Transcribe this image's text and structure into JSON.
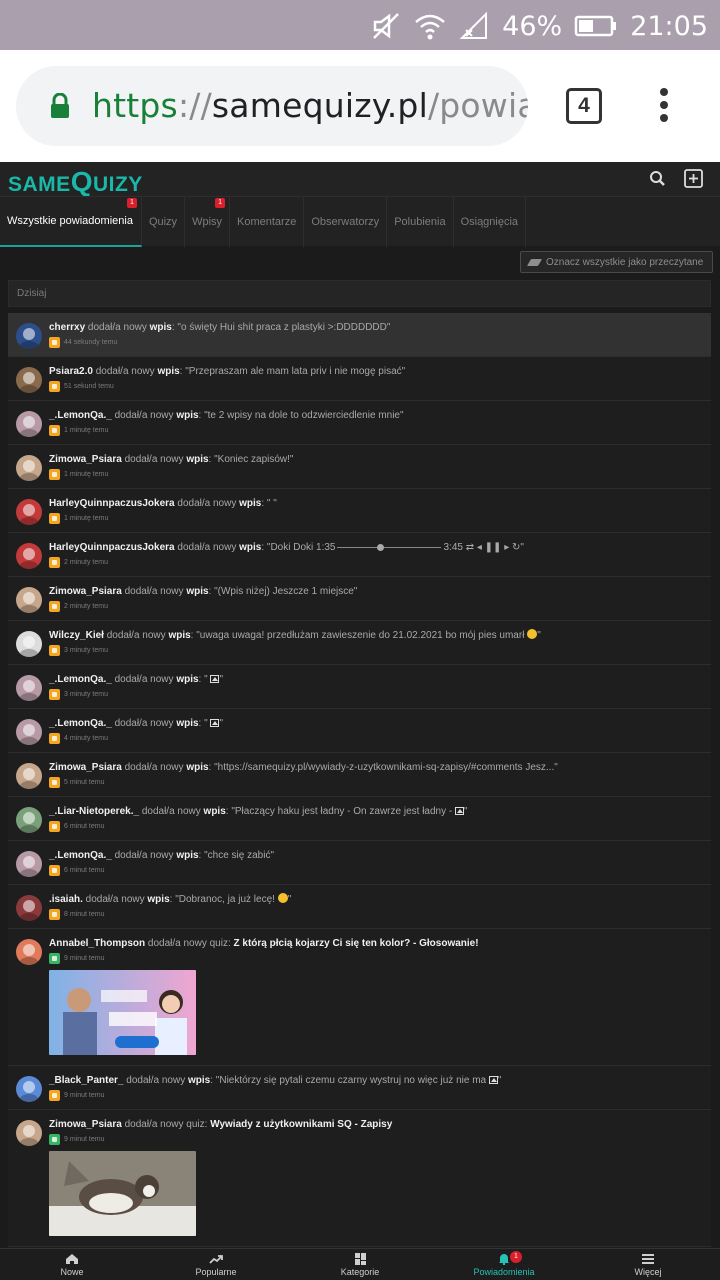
{
  "status_bar": {
    "battery": "46%",
    "time": "21:05"
  },
  "browser": {
    "url_scheme": "https",
    "url_sep": "://",
    "url_host": "samequizy.pl",
    "url_path": "/powiadomienia",
    "tab_count": "4"
  },
  "site": {
    "logo_prefix": "same",
    "logo_q": "Q",
    "logo_suffix": "uizy"
  },
  "tabs": [
    {
      "label": "Wszystkie powiadomienia",
      "badge": "1",
      "active": true
    },
    {
      "label": "Quizy",
      "badge": ""
    },
    {
      "label": "Wpisy",
      "badge": "1"
    },
    {
      "label": "Komentarze",
      "badge": ""
    },
    {
      "label": "Obserwatorzy",
      "badge": ""
    },
    {
      "label": "Polubienia",
      "badge": ""
    },
    {
      "label": "Osiągnięcia",
      "badge": ""
    }
  ],
  "mark_all_label": "Oznacz wszystkie jako przeczytane",
  "section_label": "Dzisiaj",
  "notifications": [
    {
      "user": "cherrxy",
      "action": " dodał/a nowy ",
      "kw": "wpis",
      "text": ": \"o święty Hui shit praca z plastyki >:DDDDDDD\"",
      "time": "44 sekundy temu",
      "type": "post",
      "avatar": "#2c4f8c"
    },
    {
      "user": "Psiara2.0",
      "action": " dodał/a nowy ",
      "kw": "wpis",
      "text": ": \"Przepraszam ale mam lata priv i nie mogę pisać\"",
      "time": "51 sekund temu",
      "type": "post",
      "avatar": "#8a6a4d"
    },
    {
      "user": "_.LemonQa._",
      "action": " dodał/a nowy ",
      "kw": "wpis",
      "text": ": \"te 2 wpisy na dole to odzwierciedlenie mnie\"",
      "time": "1 minutę temu",
      "type": "post",
      "avatar": "#b79aa6"
    },
    {
      "user": "Zimowa_Psiara",
      "action": " dodał/a nowy ",
      "kw": "wpis",
      "text": ": \"Koniec zapisów!\"",
      "time": "1 minutę temu",
      "type": "post",
      "avatar": "#c7a78c"
    },
    {
      "user": "HarleyQuinnpaczusJokera",
      "action": " dodał/a nowy ",
      "kw": "wpis",
      "text": ": \"                               \"",
      "time": "1 minutę temu",
      "type": "post",
      "avatar": "#c23a3a"
    },
    {
      "user": "HarleyQuinnpaczusJokera",
      "action": " dodał/a nowy ",
      "kw": "wpis",
      "text": ": \"Doki Doki 1:35",
      "text_after": "3:45 ⇄        ◂    ❚❚    ▸          ↻\"",
      "player": true,
      "time": "2 minuty temu",
      "type": "post",
      "avatar": "#c23a3a"
    },
    {
      "user": "Zimowa_Psiara",
      "action": " dodał/a nowy ",
      "kw": "wpis",
      "text": ": \"(Wpis niżej) Jeszcze 1 miejsce\"",
      "time": "2 minuty temu",
      "type": "post",
      "avatar": "#c7a78c"
    },
    {
      "user": "Wilczy_Kieł",
      "action": " dodał/a nowy ",
      "kw": "wpis",
      "text": ": \"uwaga uwaga! przedłużam zawieszenie do 21.02.2021 bo mój pies umarł ",
      "emoji": true,
      "text_after": "\"",
      "time": "3 minuty temu",
      "type": "post",
      "avatar": "#dcdcdc"
    },
    {
      "user": "_.LemonQa._",
      "action": " dodał/a nowy ",
      "kw": "wpis",
      "text": ": \" ",
      "img": true,
      "text_after": "\"",
      "time": "3 minuty temu",
      "type": "post",
      "avatar": "#b79aa6"
    },
    {
      "user": "_.LemonQa._",
      "action": " dodał/a nowy ",
      "kw": "wpis",
      "text": ": \" ",
      "img": true,
      "text_after": "\"",
      "time": "4 minuty temu",
      "type": "post",
      "avatar": "#b79aa6"
    },
    {
      "user": "Zimowa_Psiara",
      "action": " dodał/a nowy ",
      "kw": "wpis",
      "text": ": \"https://samequizy.pl/wywiady-z-uzytkownikami-sq-zapisy/#comments Jesz...\"",
      "time": "5 minut temu",
      "type": "post",
      "avatar": "#c7a78c"
    },
    {
      "user": "_.Liar-Nietoperek._",
      "action": " dodał/a nowy ",
      "kw": "wpis",
      "text": ": \"Płaczący haku jest ładny - On zawrze jest ładny - ",
      "img": true,
      "text_after": "\"",
      "time": "6 minut temu",
      "type": "post",
      "avatar": "#7aa07a"
    },
    {
      "user": "_.LemonQa._",
      "action": " dodał/a nowy ",
      "kw": "wpis",
      "text": ": \"chce się zabić\"",
      "time": "6 minut temu",
      "type": "post",
      "avatar": "#b79aa6"
    },
    {
      "user": ".isaiah.",
      "action": " dodał/a nowy ",
      "kw": "wpis",
      "text": ": \"Dobranoc, ja już lecę! ",
      "emoji": true,
      "text_after": "\"",
      "time": "8 minut temu",
      "type": "post",
      "avatar": "#8a3a3a"
    },
    {
      "user": "Annabel_Thompson",
      "action": " dodał/a nowy quiz: ",
      "quiz": "Z którą płcią kojarzy Ci się ten kolor? - Głosowanie!",
      "time": "9 minut temu",
      "type": "quiz",
      "avatar": "#e07a5a",
      "thumb": "people"
    },
    {
      "user": "_Black_Panter_",
      "action": " dodał/a nowy ",
      "kw": "wpis",
      "text": ": \"Niektórzy się pytali czemu czarny wystruj no więc już nie ma ",
      "img": true,
      "text_after": "\"",
      "time": "9 minut temu",
      "type": "post",
      "avatar": "#5a8ad8"
    },
    {
      "user": "Zimowa_Psiara",
      "action": " dodał/a nowy quiz: ",
      "quiz": "Wywiady z użytkownikami SQ - Zapisy",
      "time": "9 minut temu",
      "type": "quiz",
      "avatar": "#c7a78c",
      "thumb": "dog"
    }
  ],
  "bottom_nav": [
    {
      "label": "Nowe",
      "icon": "home-icon"
    },
    {
      "label": "Popularne",
      "icon": "trending-icon"
    },
    {
      "label": "Kategorie",
      "icon": "grid-icon"
    },
    {
      "label": "Powiadomienia",
      "icon": "bell-icon",
      "badge": "1",
      "active": true
    },
    {
      "label": "Więcej",
      "icon": "menu-icon"
    }
  ],
  "colors": {
    "accent": "#1aa39a",
    "badge": "#d91f2b",
    "post_icon": "#f2a621",
    "quiz_icon": "#37b562"
  }
}
